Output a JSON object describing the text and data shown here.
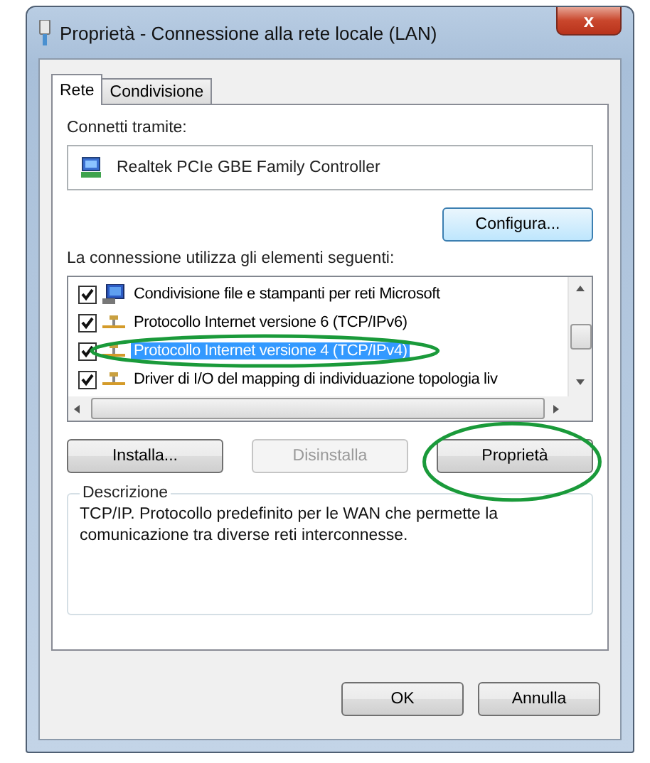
{
  "window": {
    "title": "Proprietà - Connessione alla rete locale (LAN)",
    "close": "x"
  },
  "tabs": [
    {
      "label": "Rete",
      "selected": true
    },
    {
      "label": "Condivisione",
      "selected": false
    }
  ],
  "connect_label": "Connetti tramite:",
  "adapter": "Realtek PCIe GBE Family Controller",
  "configure_button": "Configura...",
  "items_label": "La connessione utilizza gli elementi seguenti:",
  "items": [
    {
      "label": "Condivisione file e stampanti per reti Microsoft",
      "kind": "service",
      "checked": true,
      "selected": false,
      "highlighted": false
    },
    {
      "label": "Protocollo Internet versione 6 (TCP/IPv6)",
      "kind": "protocol",
      "checked": true,
      "selected": false,
      "highlighted": false
    },
    {
      "label": "Protocollo Internet versione 4 (TCP/IPv4)",
      "kind": "protocol",
      "checked": true,
      "selected": true,
      "highlighted": true
    },
    {
      "label": "Driver di I/O del mapping di individuazione topologia liv",
      "kind": "protocol",
      "checked": true,
      "selected": false,
      "highlighted": false
    }
  ],
  "item_buttons": [
    {
      "label": "Installa...",
      "disabled": false,
      "highlighted": false
    },
    {
      "label": "Disinstalla",
      "disabled": true,
      "highlighted": false
    },
    {
      "label": "Proprietà",
      "disabled": false,
      "highlighted": true
    }
  ],
  "description": {
    "title": "Descrizione",
    "text": "TCP/IP. Protocollo predefinito per le WAN che permette la comunicazione tra diverse reti interconnesse."
  },
  "dialog_buttons": [
    "OK",
    "Annulla"
  ]
}
